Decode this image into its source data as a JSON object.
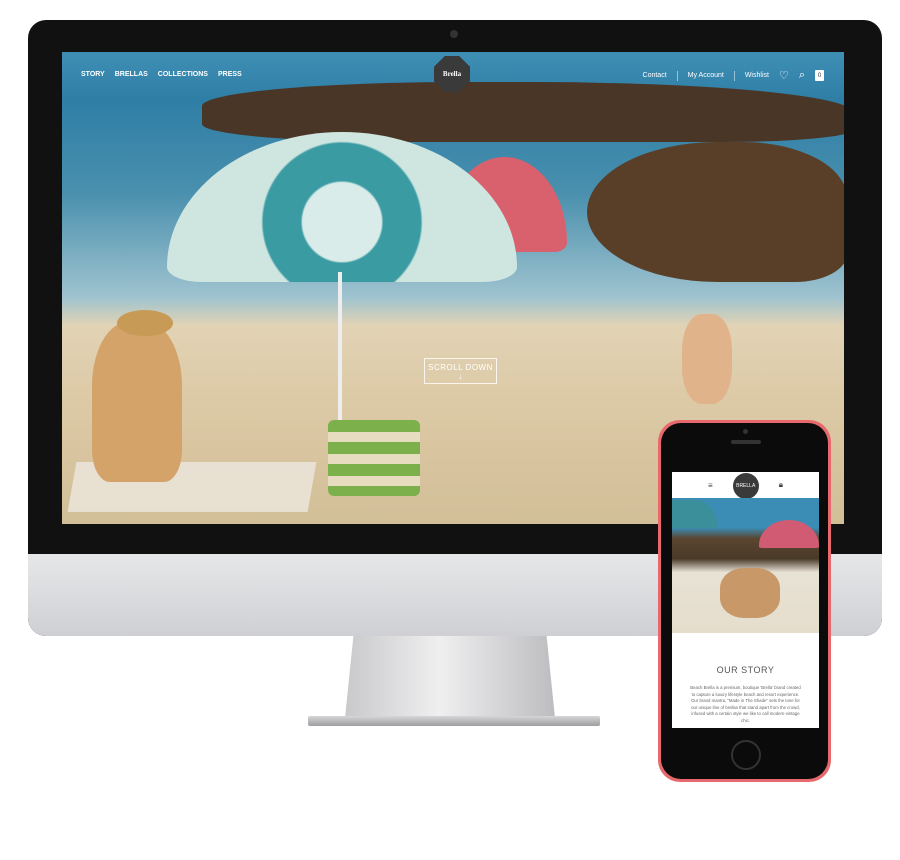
{
  "site": {
    "nav_left": [
      "STORY",
      "BRELLAS",
      "COLLECTIONS",
      "PRESS"
    ],
    "logo_text": "Brella",
    "nav_right": [
      "Contact",
      "My Account",
      "Wishlist"
    ],
    "icons": [
      "heart-icon",
      "search-icon",
      "cart-icon"
    ],
    "cart_count": "0",
    "scroll_label": "SCROLL DOWN",
    "scroll_arrow": "↓"
  },
  "mobile": {
    "menu_icon": "≡",
    "logo_text": "BRELLA",
    "title": "OUR STORY",
    "body": "Beach Brella is a premium, boutique 'Brella' brand created to capture a luxury lifestyle beach and resort experience. Our brand mantra, \"Made in The Shade\" sets the tone for our unique line of brellas that stand apart from the crowd, infused with a certain style we like to call modern-vintage chic."
  },
  "colors": {
    "phone_case": "#e8696d",
    "sea": "#2e7ea6",
    "sand": "#dcc9a5"
  }
}
